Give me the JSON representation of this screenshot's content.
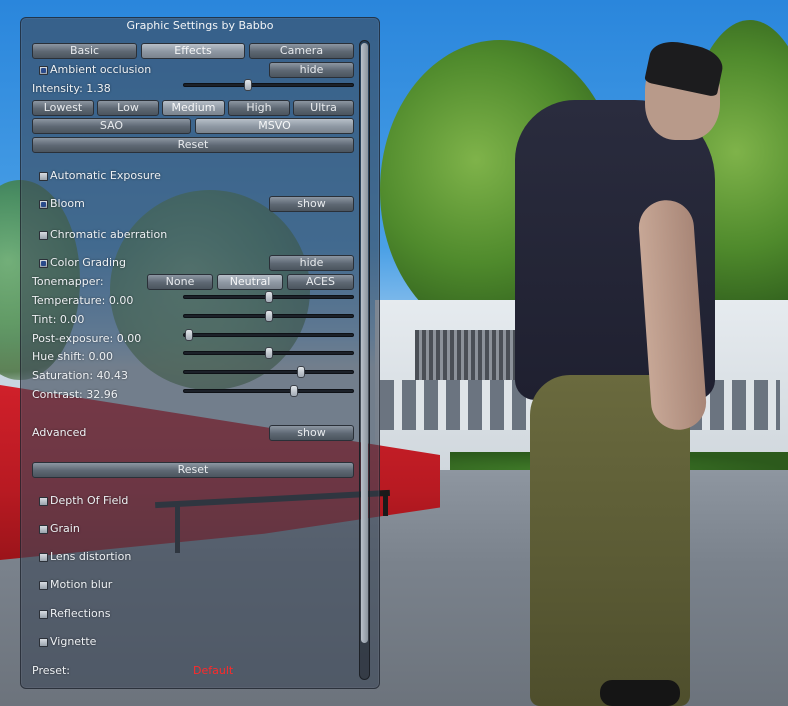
{
  "window": {
    "title": "Graphic Settings by Babbo"
  },
  "tabs": [
    {
      "label": "Basic",
      "active": false
    },
    {
      "label": "Effects",
      "active": true
    },
    {
      "label": "Camera",
      "active": false
    }
  ],
  "ambient_occlusion": {
    "label": "Ambient occlusion",
    "checked": true,
    "toggle_label": "hide",
    "intensity_label": "Intensity: 1.38",
    "intensity_fraction": 0.38,
    "quality_buttons": [
      "Lowest",
      "Low",
      "Medium",
      "High",
      "Ultra"
    ],
    "quality_active": "Medium",
    "method_buttons": [
      "SAO",
      "MSVO"
    ],
    "method_active": "MSVO",
    "reset_label": "Reset"
  },
  "automatic_exposure": {
    "label": "Automatic Exposure",
    "checked": false
  },
  "bloom": {
    "label": "Bloom",
    "checked": true,
    "toggle_label": "show"
  },
  "chromatic_aberration": {
    "label": "Chromatic aberration",
    "checked": false
  },
  "color_grading": {
    "label": "Color Grading",
    "checked": true,
    "toggle_label": "hide",
    "tonemapper_label": "Tonemapper:",
    "tonemapper_buttons": [
      "None",
      "Neutral",
      "ACES"
    ],
    "tonemapper_active": "Neutral",
    "sliders": [
      {
        "label": "Temperature: 0.00",
        "fraction": 0.5
      },
      {
        "label": "Tint: 0.00",
        "fraction": 0.5
      },
      {
        "label": "Post-exposure: 0.00",
        "fraction": 0.03
      },
      {
        "label": "Hue shift: 0.00",
        "fraction": 0.5
      },
      {
        "label": "Saturation: 40.43",
        "fraction": 0.69
      },
      {
        "label": "Contrast: 32.96",
        "fraction": 0.65
      }
    ],
    "advanced_label": "Advanced",
    "advanced_toggle_label": "show",
    "reset_label": "Reset"
  },
  "effects": [
    {
      "label": "Depth Of Field",
      "checked": false
    },
    {
      "label": "Grain",
      "checked": false
    },
    {
      "label": "Lens distortion",
      "checked": false
    },
    {
      "label": "Motion blur",
      "checked": false
    },
    {
      "label": "Reflections",
      "checked": false
    },
    {
      "label": "Vignette",
      "checked": false
    }
  ],
  "preset": {
    "label": "Preset:",
    "value": "Default"
  },
  "colors": {
    "preset_value": "#ff2a2a",
    "panel_bg": "#3e4858"
  }
}
